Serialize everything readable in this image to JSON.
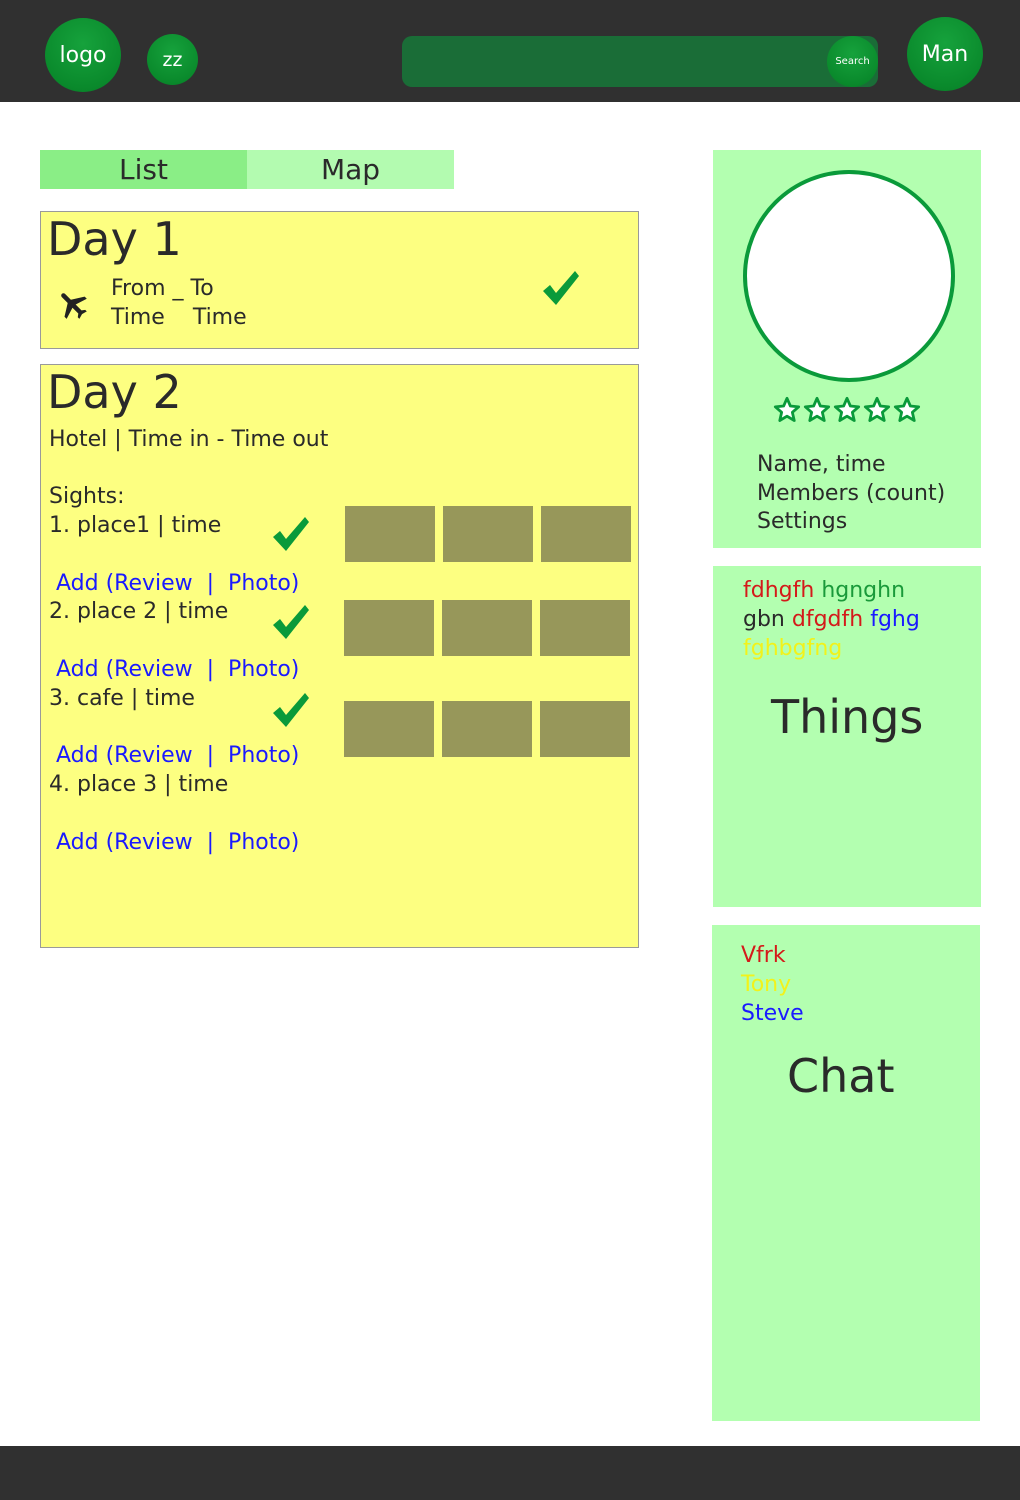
{
  "header": {
    "logo_label": "logo",
    "zz_label": "zz",
    "search_button_label": "Search",
    "user_label": "Man"
  },
  "tabs": [
    {
      "label": "List"
    },
    {
      "label": "Map"
    }
  ],
  "day1": {
    "title": "Day 1",
    "from": "From _ To",
    "time": "Time    Time"
  },
  "day2": {
    "title": "Day 2",
    "hotel": "Hotel | Time in - Time out",
    "sights_label": "Sights:",
    "items": [
      {
        "label": "1. place1 | time",
        "action": "Add (Review  |  Photo)"
      },
      {
        "label": "2. place 2 | time",
        "action": "Add (Review  |  Photo)"
      },
      {
        "label": "3. cafe | time",
        "action": "Add (Review  |  Photo)"
      },
      {
        "label": "4. place 3 | time",
        "action": "Add (Review  |  Photo)"
      }
    ]
  },
  "profile": {
    "lines": [
      "Name, time",
      "Members (count)",
      "Settings"
    ],
    "rating_stars": 5
  },
  "things": {
    "words": [
      {
        "text": "fdhgfh",
        "color": "#d41a1a"
      },
      {
        "text": "hgnghn",
        "color": "#1a9a3a"
      },
      {
        "text": "gbn",
        "color": "#2a2a2a"
      },
      {
        "text": "dfgdfh",
        "color": "#d41a1a"
      },
      {
        "text": "fghg",
        "color": "#1a1aff"
      },
      {
        "text": "fghbgfng",
        "color": "#f2f21a"
      }
    ],
    "title": "Things"
  },
  "chat": {
    "names": [
      {
        "text": "Vfrk",
        "color": "#d41a1a"
      },
      {
        "text": "Tony",
        "color": "#f2f21a"
      },
      {
        "text": "Steve",
        "color": "#1a1aff"
      }
    ],
    "title": "Chat"
  },
  "colors": {
    "accent_green": "#0a8a2c",
    "topbar": "#303030",
    "day_card": "#fdff81",
    "panel": "#b3ffb0",
    "photo_placeholder": "#97975a"
  }
}
